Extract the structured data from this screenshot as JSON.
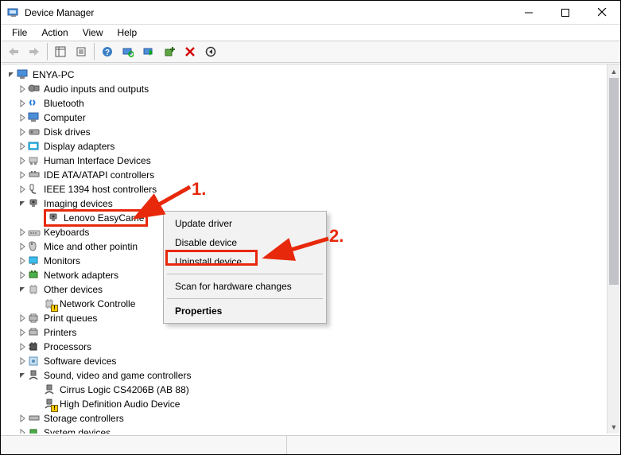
{
  "window": {
    "title": "Device Manager"
  },
  "menu": {
    "file": "File",
    "action": "Action",
    "view": "View",
    "help": "Help"
  },
  "tree": {
    "root": "ENYA-PC",
    "nodes": [
      "Audio inputs and outputs",
      "Bluetooth",
      "Computer",
      "Disk drives",
      "Display adapters",
      "Human Interface Devices",
      "IDE ATA/ATAPI controllers",
      "IEEE 1394 host controllers",
      "Imaging devices",
      "Keyboards",
      "Mice and other pointin",
      "Monitors",
      "Network adapters",
      "Other devices",
      "Print queues",
      "Printers",
      "Processors",
      "Software devices",
      "Sound, video and game controllers",
      "Storage controllers",
      "System devices"
    ],
    "imaging_child": "Lenovo  EasyCame",
    "other_child": "Network Controlle",
    "sound_children": [
      "Cirrus Logic CS4206B (AB 88)",
      "High Definition Audio Device"
    ]
  },
  "context": {
    "items": [
      "Update driver",
      "Disable device",
      "Uninstall device",
      "Scan for hardware changes",
      "Properties"
    ]
  },
  "annotations": {
    "one": "1.",
    "two": "2."
  }
}
